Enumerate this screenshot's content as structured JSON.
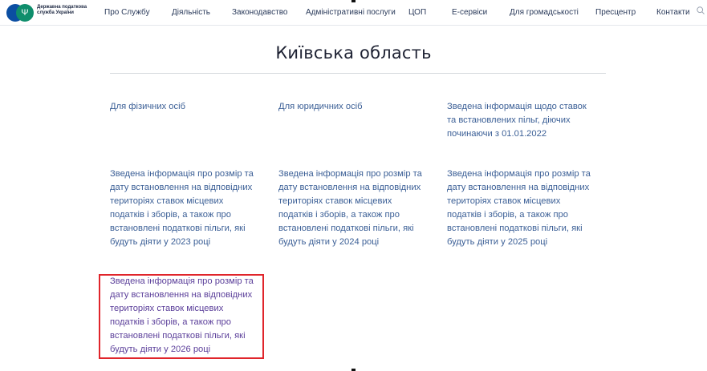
{
  "header": {
    "logo_text": "Державна податкова служба України",
    "nav": [
      {
        "label": "Про Службу"
      },
      {
        "label": "Діяльність"
      },
      {
        "label": "Законодавство"
      },
      {
        "label": "Адміністративні послуги"
      },
      {
        "label": "ЦОП"
      },
      {
        "label": "Е-сервіси"
      },
      {
        "label": "Для громадськості"
      },
      {
        "label": "Пресцентр"
      },
      {
        "label": "Контакти"
      }
    ],
    "search_icon": "search-icon"
  },
  "main": {
    "title": "Київська область",
    "tiles": [
      {
        "label": "Для фізичних осіб"
      },
      {
        "label": "Для юридичних осіб"
      },
      {
        "label": "Зведена інформація щодо ставок та встановлених пільг, діючих починаючи з 01.01.2022"
      },
      {
        "label": "Зведена інформація про розмір та дату встановлення на відповідних територіях ставок місцевих податків і зборів, а також про встановлені податкові пільги, які будуть діяти у 2023 році"
      },
      {
        "label": "Зведена інформація про розмір та дату встановлення на відповідних територіях ставок місцевих податків і зборів, а також про встановлені податкові пільги, які будуть діяти у 2024 році"
      },
      {
        "label": "Зведена інформація про розмір та дату встановлення на відповідних територіях ставок місцевих податків і зборів, а також про встановлені податкові пільги, які будуть діяти у 2025 році"
      },
      {
        "label": "Зведена інформація про розмір та дату встановлення на відповідних територіях ставок місцевих податків і зборів, а також про встановлені податкові пільги, які будуть діяти у 2026 році",
        "highlighted": true
      }
    ]
  },
  "colors": {
    "link": "#3b5f96",
    "visited_link": "#5b3f9a",
    "highlight": "#e0252b",
    "brand_blue": "#0b4ea2",
    "brand_green": "#0f8e6c"
  }
}
